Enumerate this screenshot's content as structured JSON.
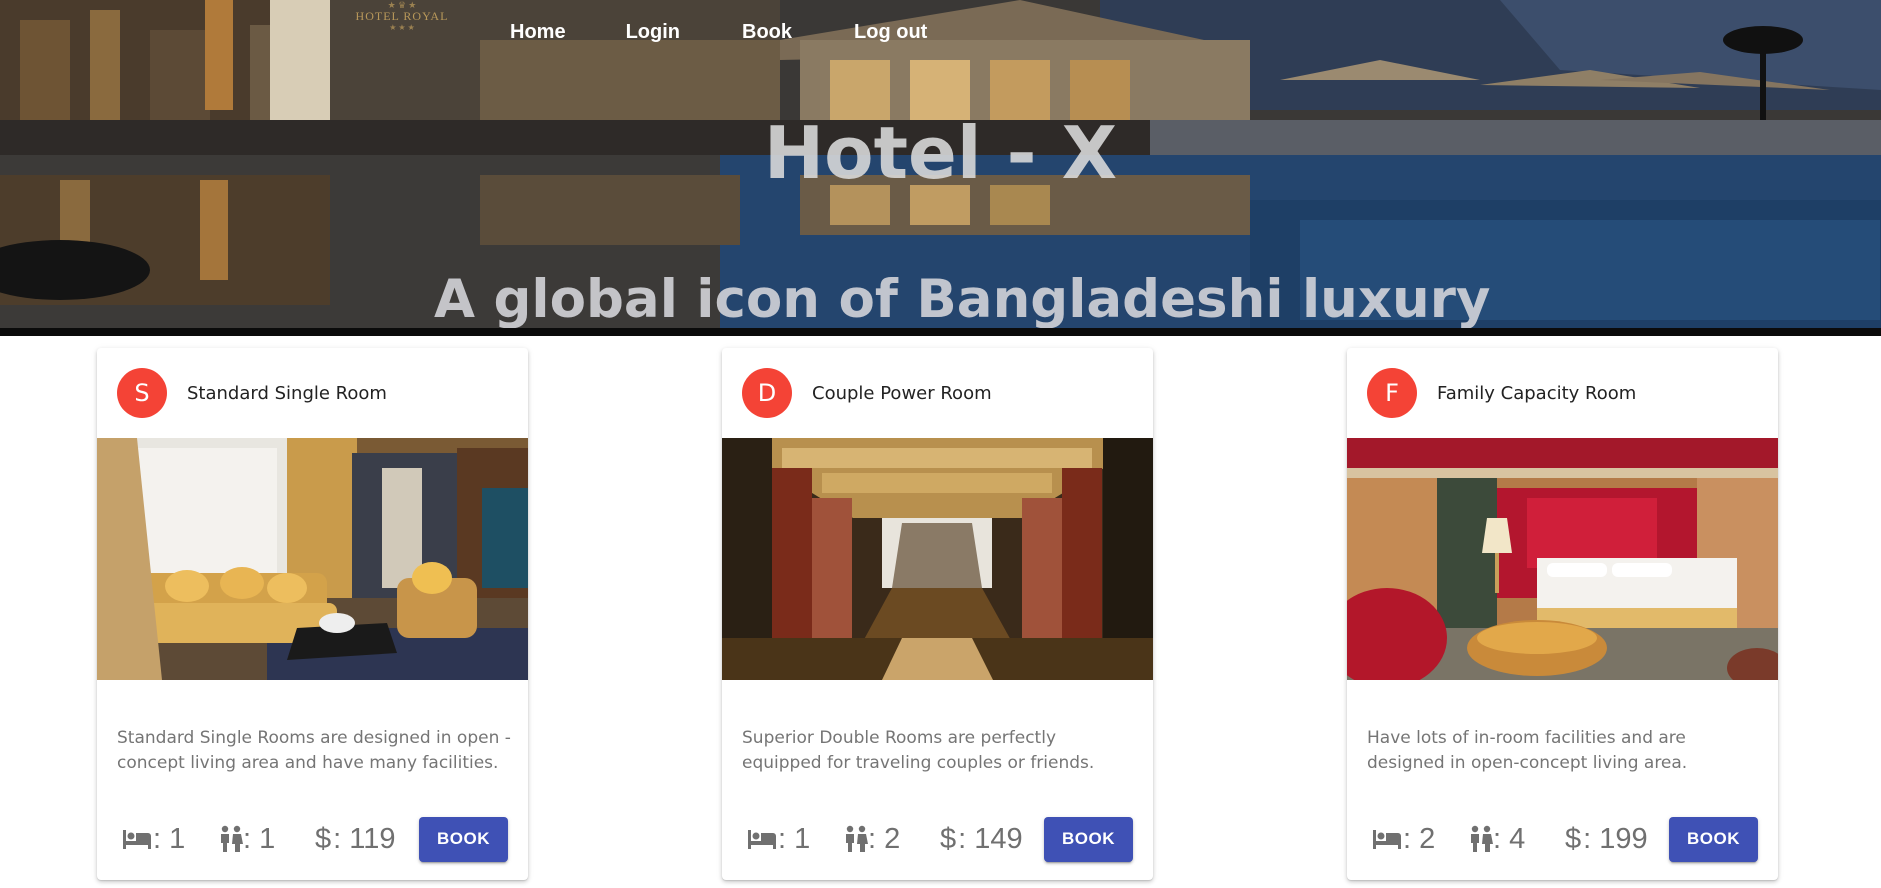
{
  "brand": {
    "logo_top": "★ ♛ ★",
    "logo_name": "HOTEL ROYAL",
    "logo_bottom": "★ ★ ★"
  },
  "nav": {
    "home": "Home",
    "login": "Login",
    "book": "Book",
    "logout": "Log out"
  },
  "hero": {
    "title": "Hotel - X",
    "subtitle": "A global icon of Bangladeshi luxury"
  },
  "colors": {
    "avatar": "#f44336",
    "primary_button": "#3f51b5",
    "description_text": "#757575"
  },
  "icons": {
    "beds": "bed-icon",
    "guests": "people-icon",
    "price": "dollar-icon"
  },
  "rooms": [
    {
      "avatar_letter": "S",
      "title": "Standard Single Room",
      "image": "living room with golden sofa",
      "description": "Standard Single Rooms are designed in open - concept living area and have many facilities.",
      "beds": ": 1",
      "guests": ": 1",
      "price_symbol": "$",
      "price": ": 119",
      "button": "BOOK"
    },
    {
      "avatar_letter": "D",
      "title": "Couple Power Room",
      "image": "grand hall with staircase",
      "description": "Superior Double Rooms are perfectly equipped for traveling couples or friends.",
      "beds": ": 1",
      "guests": ": 2",
      "price_symbol": "$",
      "price": ": 149",
      "button": "BOOK"
    },
    {
      "avatar_letter": "F",
      "title": "Family Capacity Room",
      "image": "red luxury bedroom",
      "description": "Have lots of in-room facilities and are designed in open-concept living area.",
      "beds": ": 2",
      "guests": ": 4",
      "price_symbol": "$",
      "price": ": 199",
      "button": "BOOK"
    }
  ]
}
